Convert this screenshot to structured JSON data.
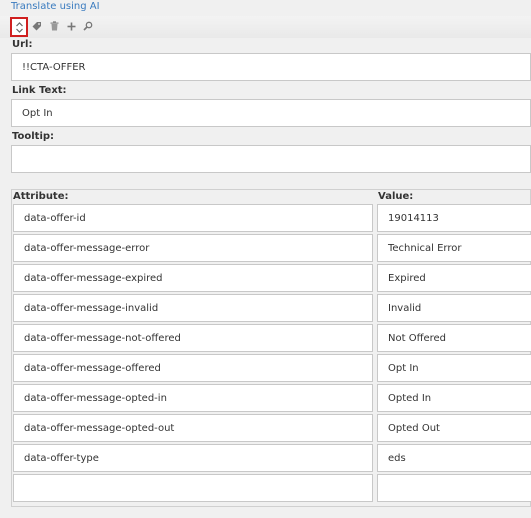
{
  "translate_link": "Translate using AI",
  "toolbar": {
    "buttons": [
      {
        "name": "collapse-toggle",
        "icon": "updown-chevron-icon",
        "active": true
      },
      {
        "name": "tag",
        "icon": "tag-icon"
      },
      {
        "name": "delete",
        "icon": "trash-icon"
      },
      {
        "name": "add",
        "icon": "plus-icon"
      },
      {
        "name": "search",
        "icon": "magnifier-icon"
      }
    ]
  },
  "fields": {
    "url": {
      "label": "Url:",
      "value": "!!CTA-OFFER"
    },
    "link_text": {
      "label": "Link Text:",
      "value": "Opt In"
    },
    "tooltip": {
      "label": "Tooltip:",
      "value": ""
    }
  },
  "attributes": {
    "header_attribute": "Attribute:",
    "header_value": "Value:",
    "rows": [
      {
        "attribute": "data-offer-id",
        "value": "19014113"
      },
      {
        "attribute": "data-offer-message-error",
        "value": "Technical Error"
      },
      {
        "attribute": "data-offer-message-expired",
        "value": "Expired"
      },
      {
        "attribute": "data-offer-message-invalid",
        "value": "Invalid"
      },
      {
        "attribute": "data-offer-message-not-offered",
        "value": "Not Offered"
      },
      {
        "attribute": "data-offer-message-offered",
        "value": "Opt In"
      },
      {
        "attribute": "data-offer-message-opted-in",
        "value": "Opted In"
      },
      {
        "attribute": "data-offer-message-opted-out",
        "value": "Opted Out"
      },
      {
        "attribute": "data-offer-type",
        "value": "eds"
      },
      {
        "attribute": "",
        "value": ""
      }
    ]
  },
  "colors": {
    "link": "#3a7bbf",
    "highlight_border": "#d01f1f",
    "background": "#f0f0f0"
  }
}
